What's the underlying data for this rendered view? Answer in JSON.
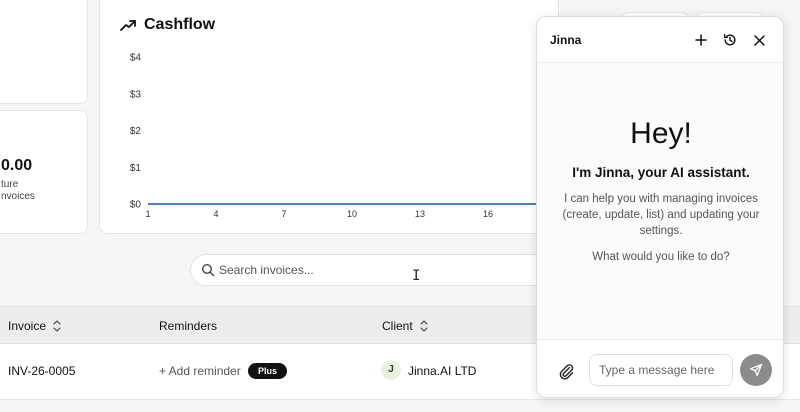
{
  "stat": {
    "value": "0.00",
    "label1": "ture",
    "label2": "nvoices"
  },
  "chart_data": {
    "type": "line",
    "title": "Cashflow",
    "xlabel": "",
    "ylabel": "",
    "x_ticks": [
      "1",
      "4",
      "7",
      "10",
      "13",
      "16"
    ],
    "y_ticks": [
      "$0",
      "$1",
      "$2",
      "$3",
      "$4"
    ],
    "ylim": [
      0,
      4
    ],
    "series": [
      {
        "values": [
          0,
          0,
          0,
          0,
          0,
          0
        ]
      }
    ],
    "grid": false,
    "colors": {
      "line": "#4a7fd4"
    }
  },
  "search": {
    "placeholder": "Search invoices..."
  },
  "table": {
    "headers": {
      "invoice": "Invoice",
      "reminders": "Reminders",
      "client": "Client"
    },
    "rows": [
      {
        "invoice": "INV-26-0005",
        "reminder": "+ Add reminder",
        "badge": "Plus",
        "client_initial": "J",
        "client": "Jinna.AI LTD"
      }
    ]
  },
  "assistant": {
    "title": "Jinna",
    "greeting": "Hey!",
    "intro": "I'm Jinna, your AI assistant.",
    "description": "I can help you with managing invoices (create, update, list) and updating your settings.",
    "question": "What would you like to do?",
    "input_placeholder": "Type a message here",
    "icons": {
      "new": "plus-icon",
      "history": "history-icon",
      "close": "close-icon",
      "attach": "paperclip-icon",
      "send": "send-icon"
    }
  }
}
